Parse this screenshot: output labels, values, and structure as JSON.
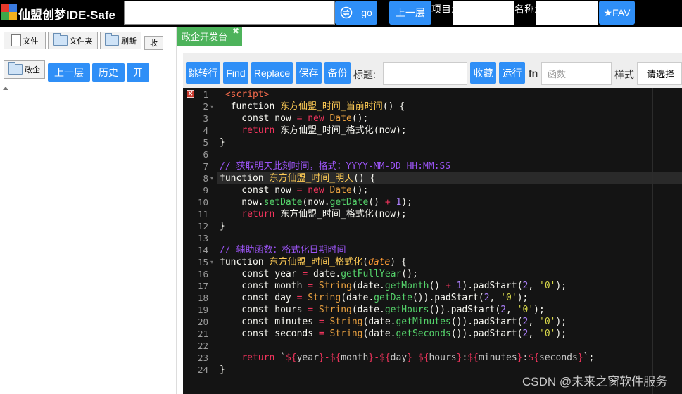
{
  "app": {
    "title": "仙盟创梦IDE-Safe"
  },
  "topbar": {
    "go_label": "go",
    "up_label": "上一层",
    "project_label": "项目:",
    "name_label": "名称:",
    "fav_label": "★FAV"
  },
  "left": {
    "file": "文件",
    "folder": "文件夹",
    "refresh": "刷新",
    "receive": "收",
    "gov": "政企",
    "up": "上一层",
    "history": "历史",
    "open": "开"
  },
  "tabs": [
    {
      "label": "政企开发台",
      "active": true
    }
  ],
  "toolbar": {
    "jump": "跳转行",
    "find": "Find",
    "replace": "Replace",
    "save": "保存",
    "backup": "备份",
    "title_label": "标题:",
    "favorite": "收藏",
    "run": "运行",
    "fn_label": "fn",
    "fn_placeholder": "函数",
    "style_label": "样式",
    "style_value": "请选择"
  },
  "editor": {
    "error_line": 1,
    "active_line": 8,
    "lines": [
      {
        "n": "1",
        "text": " <script>"
      },
      {
        "n": "2",
        "text": "  function 东方仙盟_时间_当前时间() {"
      },
      {
        "n": "3",
        "text": "    const now = new Date();"
      },
      {
        "n": "4",
        "text": "    return 东方仙盟_时间_格式化(now);"
      },
      {
        "n": "5",
        "text": "}"
      },
      {
        "n": "6",
        "text": ""
      },
      {
        "n": "7",
        "text": "// 获取明天此刻时间，格式：YYYY-MM-DD HH:MM:SS"
      },
      {
        "n": "8",
        "text": "function 东方仙盟_时间_明天() {"
      },
      {
        "n": "9",
        "text": "    const now = new Date();"
      },
      {
        "n": "10",
        "text": "    now.setDate(now.getDate() + 1);"
      },
      {
        "n": "11",
        "text": "    return 东方仙盟_时间_格式化(now);"
      },
      {
        "n": "12",
        "text": "}"
      },
      {
        "n": "13",
        "text": ""
      },
      {
        "n": "14",
        "text": "// 辅助函数：格式化日期时间"
      },
      {
        "n": "15",
        "text": "function 东方仙盟_时间_格式化(date) {"
      },
      {
        "n": "16",
        "text": "    const year = date.getFullYear();"
      },
      {
        "n": "17",
        "text": "    const month = String(date.getMonth() + 1).padStart(2, '0');"
      },
      {
        "n": "18",
        "text": "    const day = String(date.getDate()).padStart(2, '0');"
      },
      {
        "n": "19",
        "text": "    const hours = String(date.getHours()).padStart(2, '0');"
      },
      {
        "n": "20",
        "text": "    const minutes = String(date.getMinutes()).padStart(2, '0');"
      },
      {
        "n": "21",
        "text": "    const seconds = String(date.getSeconds()).padStart(2, '0');"
      },
      {
        "n": "22",
        "text": ""
      },
      {
        "n": "23",
        "text": "    return `${year}-${month}-${day} ${hours}:${minutes}:${seconds}`;"
      },
      {
        "n": "24",
        "text": "}"
      }
    ]
  },
  "watermark": "CSDN @未来之窗软件服务"
}
